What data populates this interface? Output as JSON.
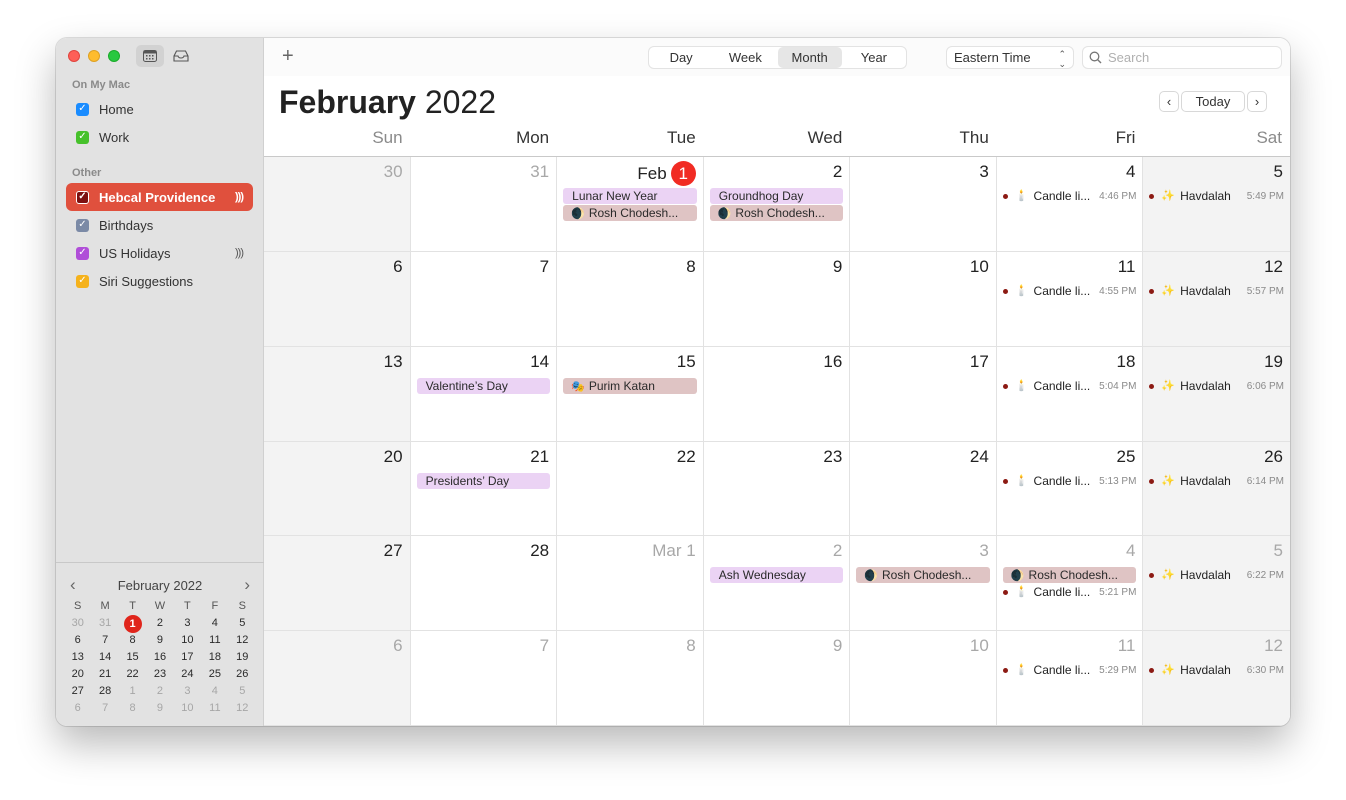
{
  "window": {
    "toolbar_icons": [
      "calendar-list-icon",
      "inbox-icon"
    ]
  },
  "sidebar": {
    "sections": [
      {
        "label": "On My Mac",
        "items": [
          {
            "label": "Home",
            "color": "#1a8cff",
            "checked": true,
            "selected": false,
            "shared": false
          },
          {
            "label": "Work",
            "color": "#46c12b",
            "checked": true,
            "selected": false,
            "shared": false
          }
        ]
      },
      {
        "label": "Other",
        "items": [
          {
            "label": "Hebcal Providence",
            "color": "#7d1010",
            "checked": true,
            "selected": true,
            "shared": true
          },
          {
            "label": "Birthdays",
            "color": "#7b8aa6",
            "checked": true,
            "selected": false,
            "shared": false
          },
          {
            "label": "US Holidays",
            "color": "#b04ed8",
            "checked": true,
            "selected": false,
            "shared": true
          },
          {
            "label": "Siri Suggestions",
            "color": "#f5b21c",
            "checked": true,
            "selected": false,
            "shared": false
          }
        ]
      }
    ],
    "mini_calendar": {
      "title": "February 2022",
      "prev": "‹",
      "next": "›",
      "weekdays": [
        "S",
        "M",
        "T",
        "W",
        "T",
        "F",
        "S"
      ],
      "weeks": [
        [
          {
            "d": "30",
            "dim": true
          },
          {
            "d": "31",
            "dim": true
          },
          {
            "d": "1",
            "today": true
          },
          {
            "d": "2"
          },
          {
            "d": "3"
          },
          {
            "d": "4"
          },
          {
            "d": "5"
          }
        ],
        [
          {
            "d": "6"
          },
          {
            "d": "7"
          },
          {
            "d": "8"
          },
          {
            "d": "9"
          },
          {
            "d": "10"
          },
          {
            "d": "11"
          },
          {
            "d": "12"
          }
        ],
        [
          {
            "d": "13"
          },
          {
            "d": "14"
          },
          {
            "d": "15"
          },
          {
            "d": "16"
          },
          {
            "d": "17"
          },
          {
            "d": "18"
          },
          {
            "d": "19"
          }
        ],
        [
          {
            "d": "20"
          },
          {
            "d": "21"
          },
          {
            "d": "22"
          },
          {
            "d": "23"
          },
          {
            "d": "24"
          },
          {
            "d": "25"
          },
          {
            "d": "26"
          }
        ],
        [
          {
            "d": "27"
          },
          {
            "d": "28"
          },
          {
            "d": "1",
            "dim": true
          },
          {
            "d": "2",
            "dim": true
          },
          {
            "d": "3",
            "dim": true
          },
          {
            "d": "4",
            "dim": true
          },
          {
            "d": "5",
            "dim": true
          }
        ],
        [
          {
            "d": "6",
            "dim": true
          },
          {
            "d": "7",
            "dim": true
          },
          {
            "d": "8",
            "dim": true
          },
          {
            "d": "9",
            "dim": true
          },
          {
            "d": "10",
            "dim": true
          },
          {
            "d": "11",
            "dim": true
          },
          {
            "d": "12",
            "dim": true
          }
        ]
      ]
    }
  },
  "toolbar": {
    "add_label": "+",
    "views": [
      {
        "label": "Day",
        "active": false
      },
      {
        "label": "Week",
        "active": false
      },
      {
        "label": "Month",
        "active": true
      },
      {
        "label": "Year",
        "active": false
      }
    ],
    "timezone": "Eastern Time",
    "search_placeholder": "Search"
  },
  "header": {
    "month": "February",
    "year": "2022",
    "prev": "‹",
    "today": "Today",
    "next": "›"
  },
  "weekdays": [
    "Sun",
    "Mon",
    "Tue",
    "Wed",
    "Thu",
    "Fri",
    "Sat"
  ],
  "event_colors": {
    "holiday": "#ebd3f4",
    "hebcal": "#dfc4c4",
    "hebcal_dot": "#8c1a13",
    "today_badge": "#f12b23"
  },
  "weeks": [
    [
      {
        "label": "30",
        "dim": true,
        "events": []
      },
      {
        "label": "31",
        "dim": true,
        "events": []
      },
      {
        "label": "Feb",
        "badge": "1",
        "events": [
          {
            "type": "holiday",
            "title": "Lunar New Year"
          },
          {
            "type": "hebcal",
            "emoji": "🌒",
            "title": "Rosh Chodesh..."
          }
        ]
      },
      {
        "label": "2",
        "events": [
          {
            "type": "holiday",
            "title": "Groundhog Day"
          },
          {
            "type": "hebcal",
            "emoji": "🌒",
            "title": "Rosh Chodesh..."
          }
        ]
      },
      {
        "label": "3",
        "events": []
      },
      {
        "label": "4",
        "events": [
          {
            "type": "timed",
            "emoji": "🕯️",
            "title": "Candle li...",
            "time": "4:46 PM"
          }
        ]
      },
      {
        "label": "5",
        "events": [
          {
            "type": "timed",
            "emoji": "✨",
            "title": "Havdalah",
            "time": "5:49 PM"
          }
        ]
      }
    ],
    [
      {
        "label": "6",
        "events": []
      },
      {
        "label": "7",
        "events": []
      },
      {
        "label": "8",
        "events": []
      },
      {
        "label": "9",
        "events": []
      },
      {
        "label": "10",
        "events": []
      },
      {
        "label": "11",
        "events": [
          {
            "type": "timed",
            "emoji": "🕯️",
            "title": "Candle li...",
            "time": "4:55 PM"
          }
        ]
      },
      {
        "label": "12",
        "events": [
          {
            "type": "timed",
            "emoji": "✨",
            "title": "Havdalah",
            "time": "5:57 PM"
          }
        ]
      }
    ],
    [
      {
        "label": "13",
        "events": []
      },
      {
        "label": "14",
        "events": [
          {
            "type": "holiday",
            "title": "Valentine’s Day"
          }
        ]
      },
      {
        "label": "15",
        "events": [
          {
            "type": "hebcal",
            "emoji": "🎭",
            "title": "Purim Katan"
          }
        ]
      },
      {
        "label": "16",
        "events": []
      },
      {
        "label": "17",
        "events": []
      },
      {
        "label": "18",
        "events": [
          {
            "type": "timed",
            "emoji": "🕯️",
            "title": "Candle li...",
            "time": "5:04 PM"
          }
        ]
      },
      {
        "label": "19",
        "events": [
          {
            "type": "timed",
            "emoji": "✨",
            "title": "Havdalah",
            "time": "6:06 PM"
          }
        ]
      }
    ],
    [
      {
        "label": "20",
        "events": []
      },
      {
        "label": "21",
        "events": [
          {
            "type": "holiday",
            "title": "Presidents’ Day"
          }
        ]
      },
      {
        "label": "22",
        "events": []
      },
      {
        "label": "23",
        "events": []
      },
      {
        "label": "24",
        "events": []
      },
      {
        "label": "25",
        "events": [
          {
            "type": "timed",
            "emoji": "🕯️",
            "title": "Candle li...",
            "time": "5:13 PM"
          }
        ]
      },
      {
        "label": "26",
        "events": [
          {
            "type": "timed",
            "emoji": "✨",
            "title": "Havdalah",
            "time": "6:14 PM"
          }
        ]
      }
    ],
    [
      {
        "label": "27",
        "events": []
      },
      {
        "label": "28",
        "events": []
      },
      {
        "label": "Mar 1",
        "dim": true,
        "events": []
      },
      {
        "label": "2",
        "dim": true,
        "events": [
          {
            "type": "holiday",
            "title": "Ash Wednesday"
          }
        ]
      },
      {
        "label": "3",
        "dim": true,
        "events": [
          {
            "type": "hebcal",
            "emoji": "🌒",
            "title": "Rosh Chodesh..."
          }
        ]
      },
      {
        "label": "4",
        "dim": true,
        "events": [
          {
            "type": "hebcal",
            "emoji": "🌒",
            "title": "Rosh Chodesh..."
          },
          {
            "type": "timed",
            "emoji": "🕯️",
            "title": "Candle li...",
            "time": "5:21 PM"
          }
        ]
      },
      {
        "label": "5",
        "dim": true,
        "events": [
          {
            "type": "timed",
            "emoji": "✨",
            "title": "Havdalah",
            "time": "6:22 PM"
          }
        ]
      }
    ],
    [
      {
        "label": "6",
        "dim": true,
        "events": []
      },
      {
        "label": "7",
        "dim": true,
        "events": []
      },
      {
        "label": "8",
        "dim": true,
        "events": []
      },
      {
        "label": "9",
        "dim": true,
        "events": []
      },
      {
        "label": "10",
        "dim": true,
        "events": []
      },
      {
        "label": "11",
        "dim": true,
        "events": [
          {
            "type": "timed",
            "emoji": "🕯️",
            "title": "Candle li...",
            "time": "5:29 PM"
          }
        ]
      },
      {
        "label": "12",
        "dim": true,
        "events": [
          {
            "type": "timed",
            "emoji": "✨",
            "title": "Havdalah",
            "time": "6:30 PM"
          }
        ]
      }
    ]
  ]
}
